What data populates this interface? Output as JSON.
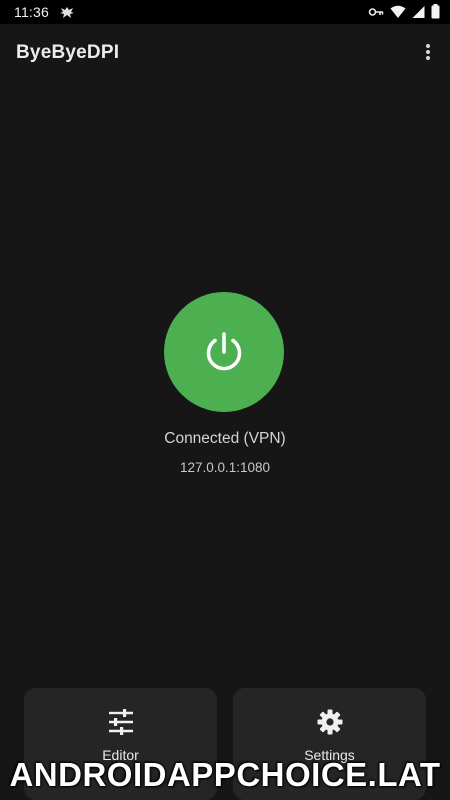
{
  "status_bar": {
    "time": "11:36",
    "icons": [
      "app-notification-icon",
      "vpn-key-icon",
      "wifi-icon",
      "cell-signal-icon",
      "battery-icon"
    ]
  },
  "app_bar": {
    "title": "ByeByeDPI",
    "menu_icon": "more-vert-icon"
  },
  "main": {
    "power_icon": "power-icon",
    "connection_status": "Connected (VPN)",
    "proxy_address": "127.0.0.1:1080"
  },
  "cards": {
    "editor": {
      "label": "Editor",
      "icon": "tune-icon"
    },
    "settings": {
      "label": "Settings",
      "icon": "gear-icon"
    }
  },
  "watermark": "ANDROIDAPPCHOICE.LAT",
  "colors": {
    "background": "#161616",
    "power_button": "#4caf50",
    "card": "#252525",
    "status_bar": "#000000"
  }
}
